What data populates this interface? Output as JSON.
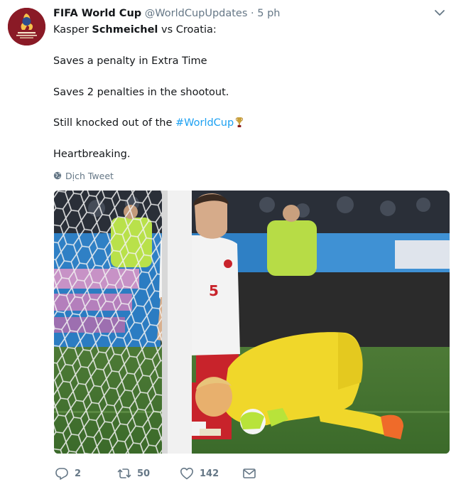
{
  "tweet": {
    "author_name": "FIFA World Cup",
    "author_handle": "@WorldCupUpdates",
    "separator": "·",
    "timestamp": "5 ph",
    "lines": {
      "line1_pre": "Kasper ",
      "line1_bold": "Schmeichel",
      "line1_post": " vs Croatia:",
      "line2": "Saves a penalty in Extra Time",
      "line3": "Saves 2 penalties in the shootout.",
      "line4_pre": "Still knocked out of the ",
      "line4_hashtag": "#WorldCup",
      "line5": "Heartbreaking."
    },
    "translate_label": "Dịch Tweet"
  },
  "actions": {
    "replies": "2",
    "retweets": "50",
    "likes": "142"
  },
  "icons": {
    "avatar": "fifa-world-cup-logo",
    "caret": "chevron-down-icon",
    "translate": "globe-icon",
    "trophy": "trophy-emoji",
    "reply": "reply-icon",
    "retweet": "retweet-icon",
    "like": "heart-icon",
    "dm": "envelope-icon"
  },
  "colors": {
    "accent": "#1da1f2",
    "secondary_text": "#657786",
    "primary_text": "#14171a"
  }
}
